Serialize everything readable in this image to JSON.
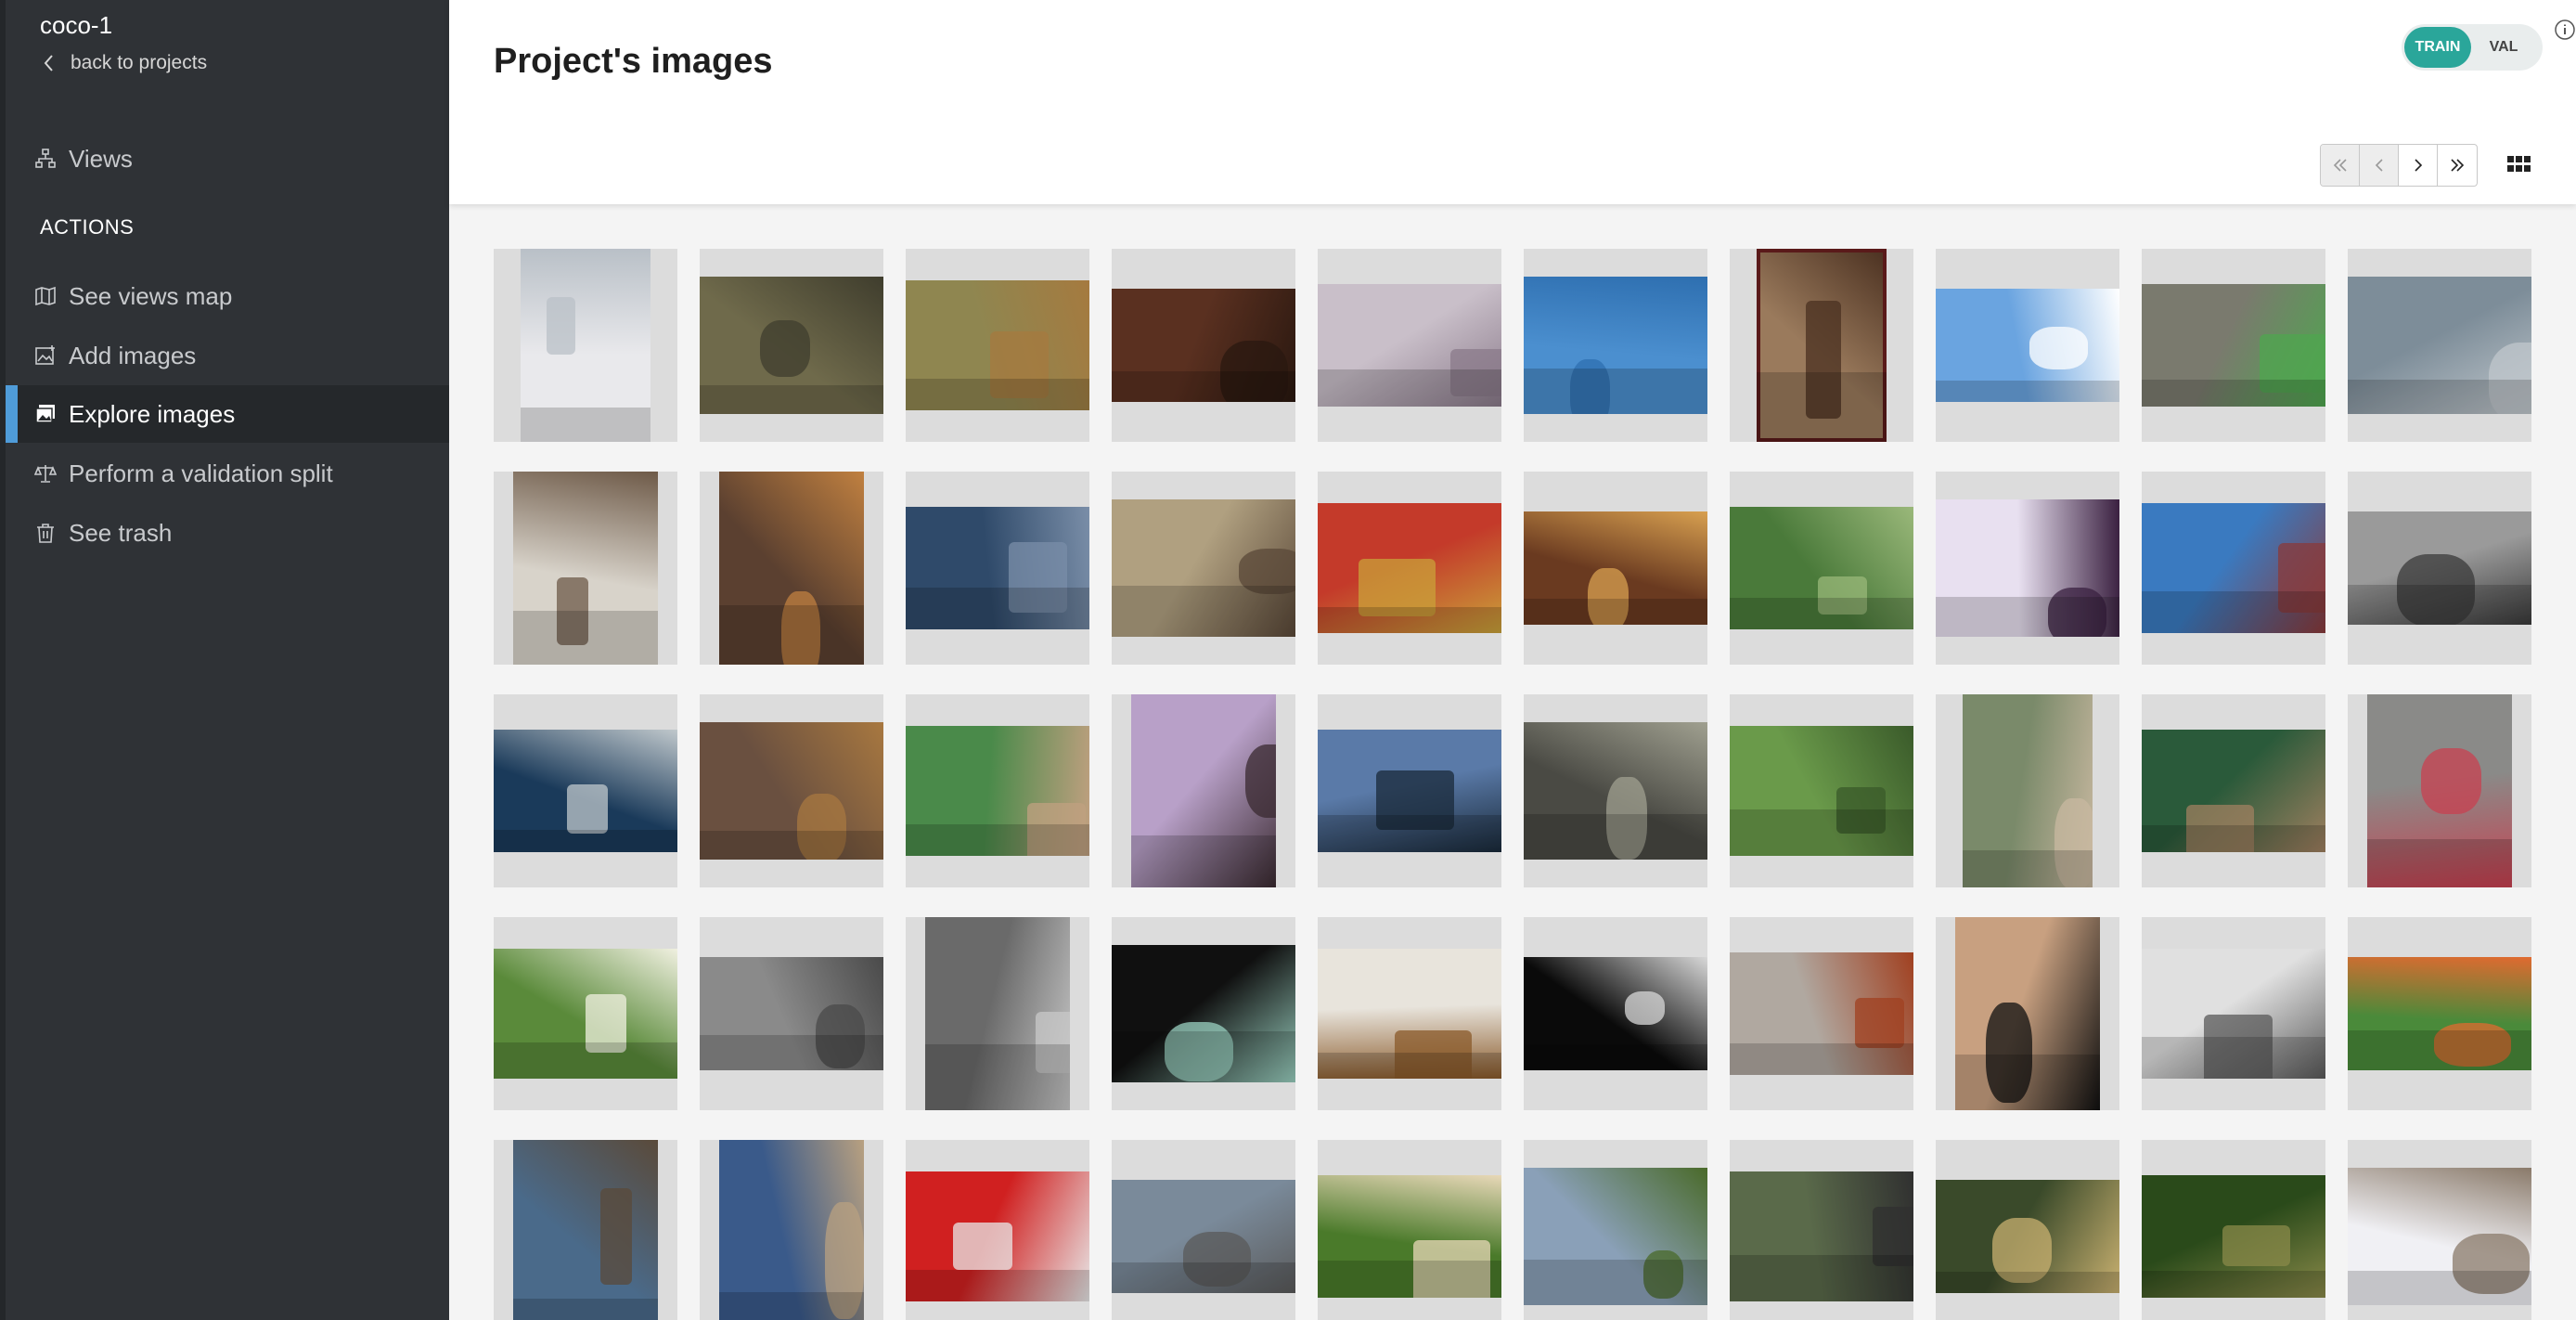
{
  "sidebar": {
    "project_name": "coco-1",
    "back_label": "back to projects",
    "views_label": "Views",
    "actions_heading": "ACTIONS",
    "items": [
      {
        "label": "See views map",
        "icon": "map-icon"
      },
      {
        "label": "Add images",
        "icon": "add-image-icon"
      },
      {
        "label": "Explore images",
        "icon": "images-icon",
        "active": true
      },
      {
        "label": "Perform a validation split",
        "icon": "scale-icon"
      },
      {
        "label": "See trash",
        "icon": "trash-icon"
      }
    ],
    "active_color": "#4f9cd9"
  },
  "header": {
    "title": "Project's images",
    "split_toggle": {
      "train_label": "TRAIN",
      "val_label": "VAL",
      "selected": "TRAIN",
      "accent": "#2aa69a"
    },
    "pagination": {
      "first": "first-page-icon",
      "prev": "previous-page-icon",
      "next": "next-page-icon",
      "last": "last-page-icon"
    },
    "view_mode_icon": "grid-view-icon"
  },
  "gallery": {
    "rows": 5,
    "columns": 10,
    "images": [
      {
        "orientation": "portrait",
        "palette": [
          "#e9e9ec",
          "#b9c0c7"
        ]
      },
      {
        "orientation": "landscape",
        "palette": [
          "#6f6a4b",
          "#3f3d2d"
        ]
      },
      {
        "orientation": "landscape",
        "palette": [
          "#8f8650",
          "#a57a3f"
        ]
      },
      {
        "orientation": "landscape",
        "palette": [
          "#5a3020",
          "#2a1810"
        ]
      },
      {
        "orientation": "landscape",
        "palette": [
          "#c9bfc9",
          "#8a7a8a"
        ]
      },
      {
        "orientation": "landscape",
        "palette": [
          "#4b8fcf",
          "#2e6fb0"
        ]
      },
      {
        "orientation": "portrait",
        "palette": [
          "#9a7a5c",
          "#4a3020"
        ],
        "selected": true
      },
      {
        "orientation": "landscape",
        "palette": [
          "#6aa4e0",
          "#ffffff"
        ]
      },
      {
        "orientation": "landscape",
        "palette": [
          "#7a7a6e",
          "#4fa64f"
        ]
      },
      {
        "orientation": "landscape",
        "palette": [
          "#7d8d99",
          "#c0c7cc"
        ]
      },
      {
        "orientation": "portrait",
        "palette": [
          "#d8d3ca",
          "#6e5a48"
        ]
      },
      {
        "orientation": "portrait",
        "palette": [
          "#5b4030",
          "#c08040"
        ]
      },
      {
        "orientation": "landscape",
        "palette": [
          "#2f4a6a",
          "#7a8ea8"
        ]
      },
      {
        "orientation": "landscape",
        "palette": [
          "#b0a080",
          "#5a4838"
        ]
      },
      {
        "orientation": "landscape",
        "palette": [
          "#c43a2a",
          "#c9a23a"
        ]
      },
      {
        "orientation": "landscape",
        "palette": [
          "#6a3a20",
          "#d8a050"
        ]
      },
      {
        "orientation": "landscape",
        "palette": [
          "#4a7a3a",
          "#9ab87a"
        ]
      },
      {
        "orientation": "landscape",
        "palette": [
          "#e8e0f0",
          "#3a2040"
        ]
      },
      {
        "orientation": "landscape",
        "palette": [
          "#3a7ac0",
          "#8a3a3a"
        ]
      },
      {
        "orientation": "landscape",
        "palette": [
          "#9a9a9a",
          "#3a3a3a"
        ]
      },
      {
        "orientation": "landscape",
        "palette": [
          "#1a3a5a",
          "#c0c8cc"
        ]
      },
      {
        "orientation": "landscape",
        "palette": [
          "#6a5040",
          "#a87840"
        ]
      },
      {
        "orientation": "landscape",
        "palette": [
          "#4a8a4a",
          "#c0a080"
        ]
      },
      {
        "orientation": "portrait",
        "palette": [
          "#b8a0c8",
          "#3a2a30"
        ]
      },
      {
        "orientation": "landscape",
        "palette": [
          "#5a7aa8",
          "#1a2a3a"
        ]
      },
      {
        "orientation": "landscape",
        "palette": [
          "#4a4a44",
          "#a0a090"
        ]
      },
      {
        "orientation": "landscape",
        "palette": [
          "#6a9a4a",
          "#3a5a2a"
        ]
      },
      {
        "orientation": "portrait",
        "palette": [
          "#7a8a6a",
          "#c8b8a0"
        ]
      },
      {
        "orientation": "landscape",
        "palette": [
          "#2a5a3a",
          "#a08060"
        ]
      },
      {
        "orientation": "portrait",
        "palette": [
          "#8a8a88",
          "#c84050"
        ]
      },
      {
        "orientation": "landscape",
        "palette": [
          "#5a8a3a",
          "#f0f0e0"
        ]
      },
      {
        "orientation": "landscape",
        "palette": [
          "#8a8a8a",
          "#4a4a4a"
        ]
      },
      {
        "orientation": "portrait",
        "palette": [
          "#6a6a6a",
          "#c8c8c8"
        ]
      },
      {
        "orientation": "landscape",
        "palette": [
          "#101010",
          "#9ad0c0"
        ]
      },
      {
        "orientation": "landscape",
        "palette": [
          "#e8e4dc",
          "#8a5a2a"
        ]
      },
      {
        "orientation": "landscape",
        "palette": [
          "#0a0a0a",
          "#d8d8d8"
        ]
      },
      {
        "orientation": "landscape",
        "palette": [
          "#b0a8a0",
          "#a04020"
        ]
      },
      {
        "orientation": "portrait",
        "palette": [
          "#c8a080",
          "#101010"
        ]
      },
      {
        "orientation": "landscape",
        "palette": [
          "#e0e0e0",
          "#5a5a5a"
        ]
      },
      {
        "orientation": "landscape",
        "palette": [
          "#4a8a3a",
          "#e06a30"
        ]
      },
      {
        "orientation": "portrait",
        "palette": [
          "#4a6a8a",
          "#5a4a3a"
        ]
      },
      {
        "orientation": "portrait",
        "palette": [
          "#3a5a8a",
          "#b8a080"
        ]
      },
      {
        "orientation": "landscape",
        "palette": [
          "#d02020",
          "#e8e8e8"
        ]
      },
      {
        "orientation": "landscape",
        "palette": [
          "#7a8a9a",
          "#5a5a5a"
        ]
      },
      {
        "orientation": "landscape",
        "palette": [
          "#4a7a2a",
          "#e8d8b8"
        ]
      },
      {
        "orientation": "landscape",
        "palette": [
          "#8aa0b8",
          "#4a6a2a"
        ]
      },
      {
        "orientation": "landscape",
        "palette": [
          "#5a6a4a",
          "#303030"
        ]
      },
      {
        "orientation": "landscape",
        "palette": [
          "#3a4a2a",
          "#c8b070"
        ]
      },
      {
        "orientation": "landscape",
        "palette": [
          "#2a4a1a",
          "#8a8a4a"
        ]
      },
      {
        "orientation": "landscape",
        "palette": [
          "#f0f0f4",
          "#8a7a6a"
        ]
      }
    ]
  }
}
